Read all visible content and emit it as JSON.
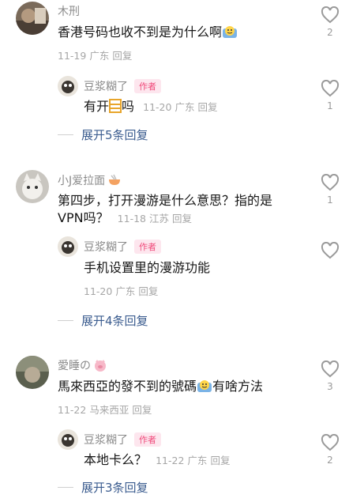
{
  "threads": [
    {
      "user": "木刑",
      "text": "香港号码也收不到是为什么啊",
      "time": "11-19",
      "location": "广东",
      "reply_label": "回复",
      "likes": "2",
      "reply": {
        "user": "豆浆糊了",
        "badge": "作者",
        "text_a": "有开",
        "text_b": "吗",
        "time": "11-20",
        "location": "广东",
        "reply_label": "回复",
        "likes": "1"
      },
      "expand_label": "展开5条回复"
    },
    {
      "user": "小J爱拉面",
      "text_line1": "第四步，打开漫游是什么意思？指的是",
      "text_line2": "VPN吗？",
      "time": "11-18",
      "location": "江苏",
      "reply_label": "回复",
      "likes": "1",
      "reply": {
        "user": "豆浆糊了",
        "badge": "作者",
        "text": "手机设置里的漫游功能",
        "time": "11-20",
        "location": "广东",
        "reply_label": "回复",
        "likes": ""
      },
      "expand_label": "展开4条回复"
    },
    {
      "user": "愛睡の",
      "text_a": "馬來西亞的發不到的號碼",
      "text_b": "有啥方法",
      "time": "11-22",
      "location": "马来西亚",
      "reply_label": "回复",
      "likes": "3",
      "reply": {
        "user": "豆浆糊了",
        "badge": "作者",
        "text": "本地卡么？",
        "time": "11-22",
        "location": "广东",
        "reply_label": "回复",
        "likes": "2"
      },
      "expand_label": "展开3条回复"
    }
  ],
  "icons": {
    "like": "heart-outline-icon",
    "emoji_face": "sweat-face-emoji",
    "emoji_ramen": "ramen-emoji",
    "emoji_pig": "pig-emoji"
  },
  "colors": {
    "link": "#3b5c8f",
    "badge_text": "#f0497a",
    "badge_bg": "#fde6ee",
    "meta": "#a6a6a6"
  }
}
